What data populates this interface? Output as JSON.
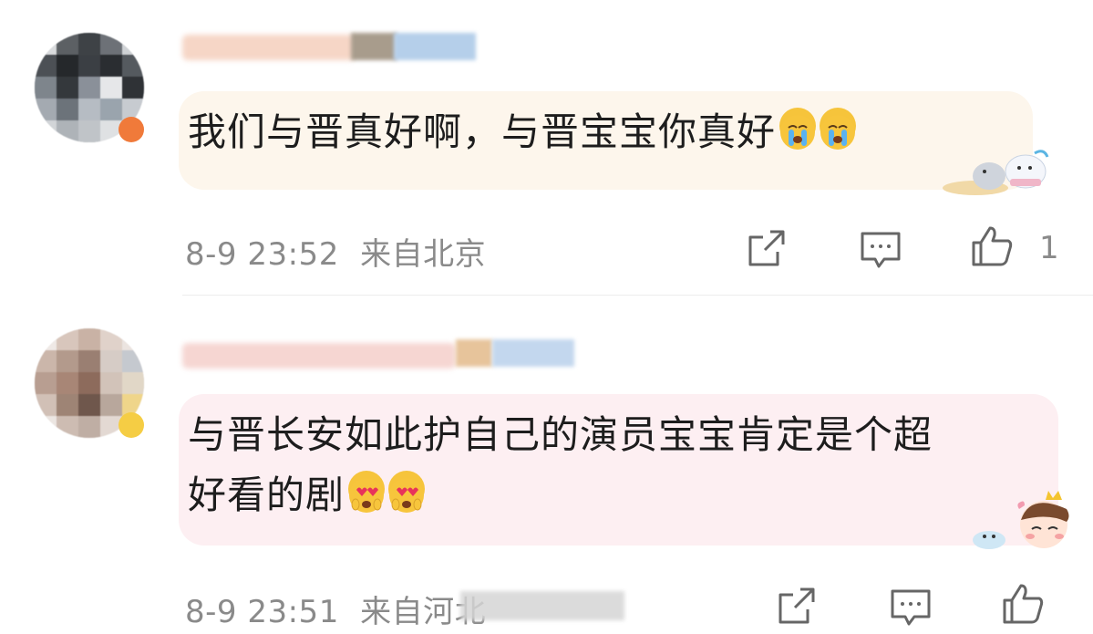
{
  "comments": [
    {
      "text": "我们与晋真好啊，与晋宝宝你真好",
      "emojis": [
        "crying-face",
        "crying-face"
      ],
      "timestamp": "8-9 23:52",
      "location": "来自北京",
      "like_count": "1",
      "bubble_color": "#fdf6ec"
    },
    {
      "text_line1": "与晋长安如此护自己的演员宝宝肯定是个超",
      "text_line2": "好看的剧",
      "emojis": [
        "heart-eyes-face",
        "heart-eyes-face"
      ],
      "timestamp": "8-9 23:51",
      "location": "来自河北",
      "like_count": "",
      "bubble_color": "#fdeff2"
    }
  ],
  "icons": {
    "share": "share-icon",
    "reply": "comment-icon",
    "like": "thumbs-up-icon"
  }
}
